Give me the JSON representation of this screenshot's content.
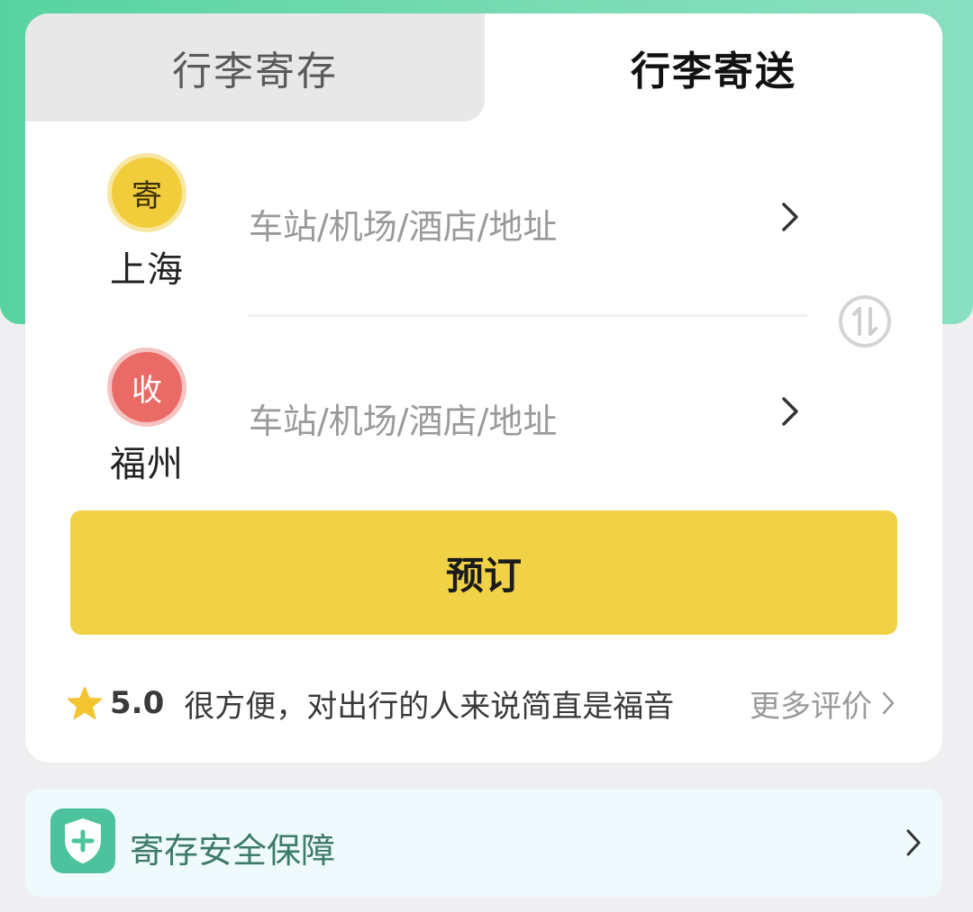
{
  "tabs": {
    "storage_label": "行李寄存",
    "delivery_label": "行李寄送"
  },
  "sender": {
    "badge": "寄",
    "city": "上海",
    "placeholder": "车站/机场/酒店/地址"
  },
  "receiver": {
    "badge": "收",
    "city": "福州",
    "placeholder": "车站/机场/酒店/地址"
  },
  "book_button": "预订",
  "review": {
    "score": "5.0",
    "text": "很方便，对出行的人来说简直是福音",
    "more_label": "更多评价"
  },
  "safety": {
    "label": "寄存安全保障"
  },
  "icons": {
    "swap": "swap-icon",
    "chevron": "chevron-right-icon",
    "star": "star-icon",
    "shield": "shield-plus-icon"
  },
  "colors": {
    "brand_green": "#57d3a1",
    "button_yellow": "#f1d247",
    "send_badge": "#f1cd3c",
    "recv_badge": "#ea6a66"
  }
}
